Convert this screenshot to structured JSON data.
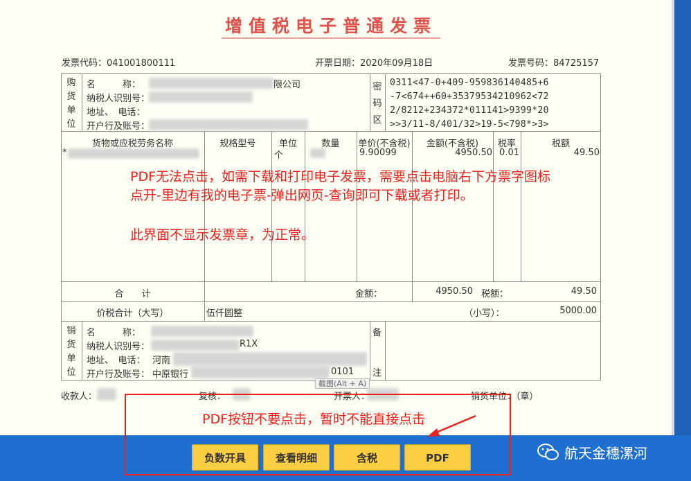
{
  "invoice": {
    "title": "增值税电子普通发票",
    "code_label": "发票代码：041001800111",
    "date_label": "开票日期：2020年09月18日",
    "number_label": "发票号码：84725157",
    "buyer": {
      "side_label": [
        "购",
        "货",
        "单",
        "位"
      ],
      "name_label": "名　　　称：",
      "name_suffix": "限公司",
      "tax_id_label": "纳税人识别号：",
      "address_label": "地址、　电话：",
      "bank_label": "开户行及账号："
    },
    "cipher_label": [
      "密",
      "码",
      "区"
    ],
    "cipher_lines": [
      "0311<47-0+409-959836140485+6",
      "-7<674++60+35379534210962<72",
      "2/8212+234372*011141>9399*20",
      ">>3/11-8/401/32>19-5<798*>3>"
    ],
    "columns": {
      "goods": "货物或应税劳务名称",
      "spec": "规格型号",
      "unit": "单位",
      "qty": "数量",
      "price": "单价(不含税)",
      "amount": "金额(不含税)",
      "rate": "税率",
      "tax": "税额"
    },
    "item": {
      "prefix": "*",
      "unit": "个",
      "price": "9.90099",
      "amount": "4950.50",
      "rate": "0.01",
      "tax": "49.50"
    },
    "total_label": "合　　计",
    "total_amount_label": "金额：",
    "total_amount": "4950.50",
    "total_tax_label": "税额：",
    "total_tax": "49.50",
    "sum_label": "价税合计（大写）",
    "sum_upper": "伍仟圆整",
    "sum_lower_label": "（小写）：",
    "sum_lower": "5000.00",
    "seller": {
      "side_label": [
        "销",
        "货",
        "单",
        "位"
      ],
      "name_label": "名　　　称：",
      "tax_id_label": "纳税人识别号：",
      "tax_id_tail": "R1X",
      "address_label": "地址、　电话：",
      "address_head": "河南",
      "bank_label": "开户行及账号：",
      "bank_head": "中原银行",
      "bank_tail": "0101"
    },
    "remark_label": [
      "备",
      "注"
    ],
    "screenshot_hint": "截图(Alt + A)",
    "payee_label": "收款人：",
    "reviewer_label": "复核：",
    "issuer_label": "开票人：",
    "seller_seal_label": "销货单位：（章）"
  },
  "notes": {
    "line1": "PDF无法点击，如需下载和打印电子发票，需要点击电脑右下方票字图标",
    "line2": "点开-里边有我的电子票-弹出网页-查询即可下载或者打印。",
    "line3": "此界面不显示发票章，为正常。",
    "pdf_warning": "PDF按钮不要点击，暂时不能直接点击"
  },
  "buttons": {
    "negative": "负数开具",
    "detail": "查看明细",
    "tax": "含税",
    "pdf": "PDF"
  },
  "watermark": "航天金穗漯河",
  "colors": {
    "title_red": "#e0534d",
    "note_red": "#e8231f",
    "bar_blue": "#1f6fd0",
    "button_yellow": "#fccf43"
  }
}
